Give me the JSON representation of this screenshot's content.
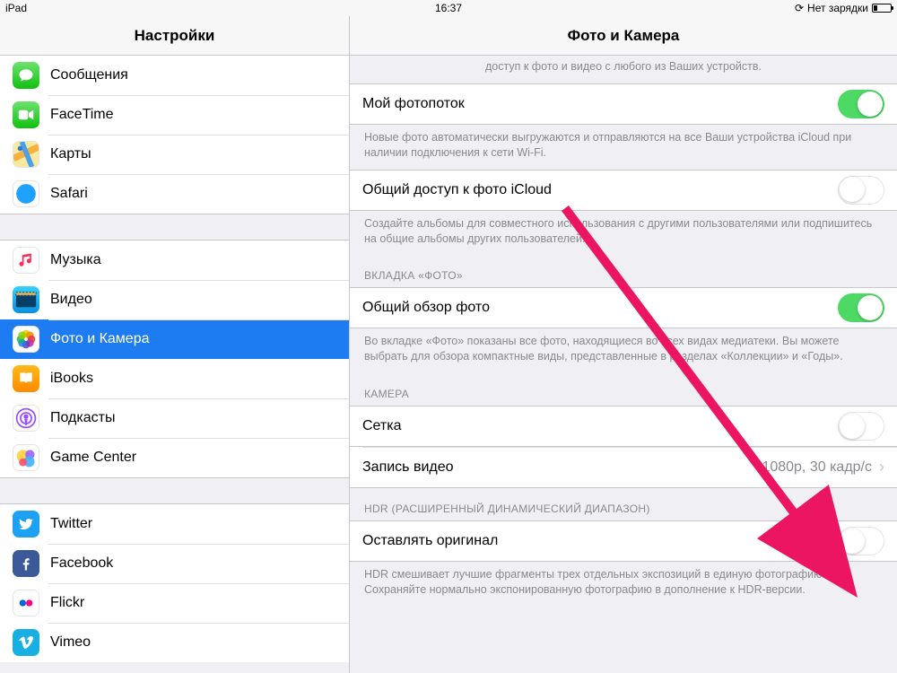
{
  "statusbar": {
    "device": "iPad",
    "time": "16:37",
    "charge": "Нет зарядки"
  },
  "headers": {
    "left": "Настройки",
    "right": "Фото и Камера"
  },
  "sidebar": {
    "g1": [
      {
        "label": "Сообщения"
      },
      {
        "label": "FaceTime"
      },
      {
        "label": "Карты"
      },
      {
        "label": "Safari"
      }
    ],
    "g2": [
      {
        "label": "Музыка"
      },
      {
        "label": "Видео"
      },
      {
        "label": "Фото и Камера"
      },
      {
        "label": "iBooks"
      },
      {
        "label": "Подкасты"
      },
      {
        "label": "Game Center"
      }
    ],
    "g3": [
      {
        "label": "Twitter"
      },
      {
        "label": "Facebook"
      },
      {
        "label": "Flickr"
      },
      {
        "label": "Vimeo"
      }
    ]
  },
  "detail": {
    "topFooter": "доступ к фото и видео с любого из Ваших устройств.",
    "photostream": {
      "label": "Мой фотопоток",
      "footer": "Новые фото автоматически выгружаются и отправляются на все Ваши устройства iCloud при наличии подключения к сети Wi-Fi."
    },
    "icloudShare": {
      "label": "Общий доступ к фото iCloud",
      "footer": "Создайте альбомы для совместного использования с другими пользователями или подпишитесь на общие альбомы других пользователей."
    },
    "tabHeader": "ВКЛАДКА «ФОТО»",
    "overview": {
      "label": "Общий обзор фото",
      "footer": "Во вкладке «Фото» показаны все фото, находящиеся во всех видах медиатеки. Вы можете выбрать для обзора компактные виды, представленные в разделах «Коллекции» и «Годы»."
    },
    "cameraHeader": "КАМЕРА",
    "grid": {
      "label": "Сетка"
    },
    "video": {
      "label": "Запись видео",
      "value": "1080p, 30 кадр/с"
    },
    "hdrHeader": "HDR (РАСШИРЕННЫЙ ДИНАМИЧЕСКИЙ ДИАПАЗОН)",
    "hdr": {
      "label": "Оставлять оригинал",
      "footer": "HDR смешивает лучшие фрагменты трех отдельных экспозиций в единую фотографию. Сохраняйте нормально экспонированную фотографию в дополнение к HDR-версии."
    }
  }
}
